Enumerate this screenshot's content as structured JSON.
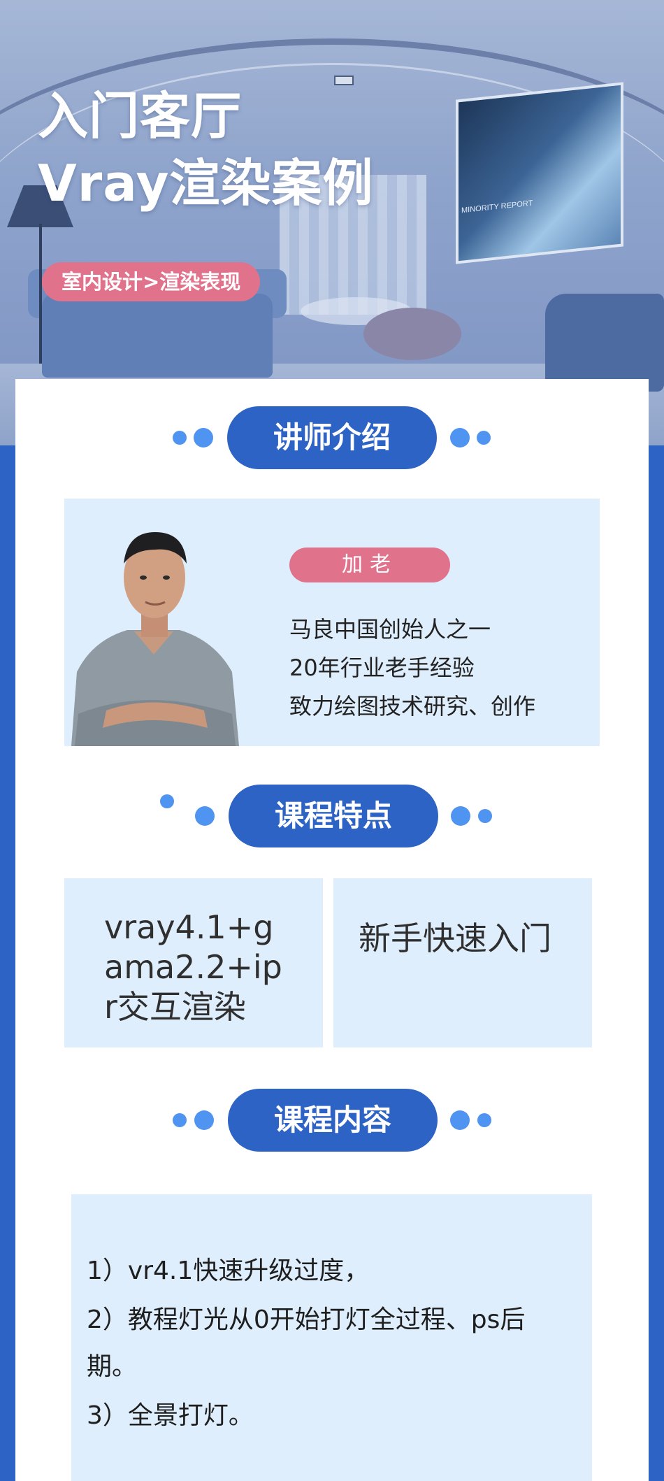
{
  "hero": {
    "title_line1": "入门客厅",
    "title_line2": "Vray渲染案例",
    "tag": "室内设计>渲染表现",
    "tv_caption": "MINORITY REPORT"
  },
  "sections": {
    "instructor": "讲师介绍",
    "features": "课程特点",
    "content": "课程内容"
  },
  "instructor": {
    "name": "加老",
    "bio": [
      "马良中国创始人之一",
      "20年行业老手经验",
      "致力绘图技术研究、创作"
    ]
  },
  "features": [
    "vray4.1+gama2.2+ipr交互渲染",
    "新手快速入门"
  ],
  "content": [
    "1）vr4.1快速升级过度，",
    "2）教程灯光从0开始打灯全过程、ps后",
    "期。",
    "3）全景打灯。"
  ],
  "colors": {
    "brand_blue": "#2e63c6",
    "accent_pink": "#e1728c",
    "panel_bg": "#dfeefc",
    "dot_blue": "#4f94f0"
  }
}
